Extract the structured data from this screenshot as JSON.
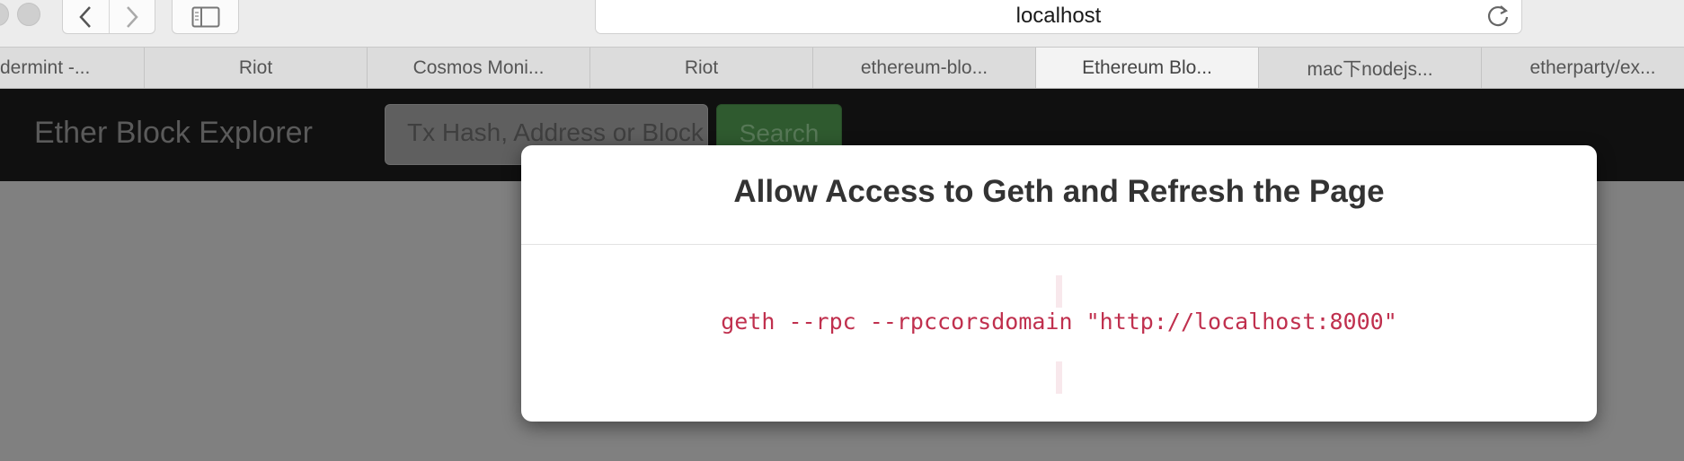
{
  "browser": {
    "url": "localhost",
    "tabs": [
      {
        "label": "dermint -..."
      },
      {
        "label": "Riot"
      },
      {
        "label": "Cosmos Moni..."
      },
      {
        "label": "Riot"
      },
      {
        "label": "ethereum-blo..."
      },
      {
        "label": "Ethereum Blo..."
      },
      {
        "label": "mac下nodejs..."
      },
      {
        "label": "etherparty/ex..."
      }
    ]
  },
  "navbar": {
    "brand": "Ether Block Explorer",
    "search_placeholder": "Tx Hash, Address or Block #",
    "search_button": "Search"
  },
  "modal": {
    "title": "Allow Access to Geth and Refresh the Page",
    "command": "geth --rpc --rpccorsdomain \"http://localhost:8000\""
  },
  "icons": [
    "back-icon",
    "forward-icon",
    "sidebar-icon",
    "reload-icon"
  ]
}
